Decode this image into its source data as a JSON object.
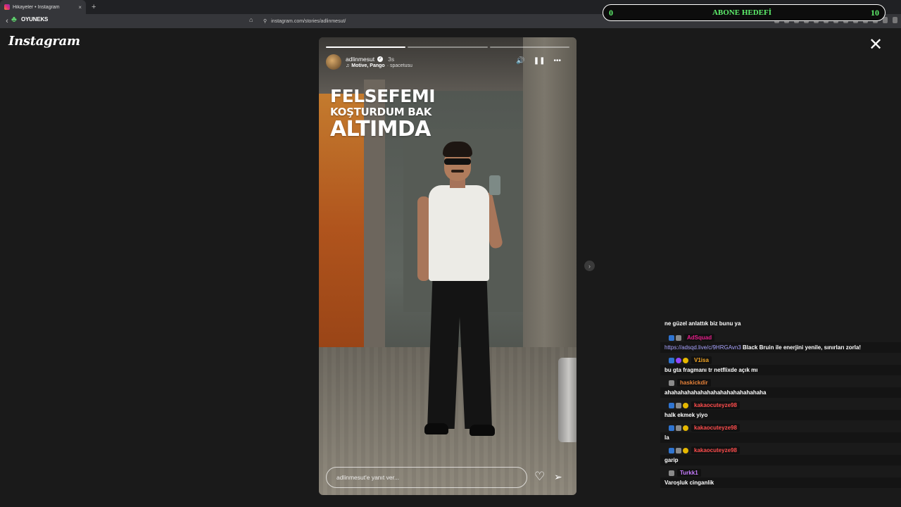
{
  "browser": {
    "tab_title": "Hikayeler • Instagram",
    "tab_close": "×",
    "new_tab": "+",
    "back": "‹",
    "url": "instagram.com/stories/adlinmesut/",
    "site_info": "⚲",
    "bookmark": "⌂"
  },
  "overlay_logo": {
    "mark": "♣",
    "text": "OYUNEKS"
  },
  "sub_goal": {
    "current": "0",
    "label": "ABONE HEDEFİ",
    "target": "10"
  },
  "instagram": {
    "brand": "Instagram",
    "close": "✕",
    "next": "›"
  },
  "story": {
    "progress": [
      1,
      0,
      0
    ],
    "username": "adlinmesut",
    "verified": "✓",
    "age": "3s",
    "music_icon": "♫",
    "song": "Motive, Pango",
    "artist": "· spacetusu",
    "controls": {
      "mute": "🔊",
      "pause": "❚❚",
      "more": "•••"
    },
    "caption": [
      "FELSEFEMI",
      "KOŞTURDUM BAK",
      "ALTIMDA"
    ],
    "reply_placeholder": "adlinmesut'e yanıt ver...",
    "like": "♡",
    "share": "➢"
  },
  "chat": {
    "partial_first": "ne güzel anlattık biz bunu ya",
    "messages": [
      {
        "user": "AdSquad",
        "color": "#e91e8c",
        "badges": [
          "blue",
          "gray"
        ],
        "link": "https://adsqd.live/c/9HRGAvn3",
        "text": "Black Bruin ile enerjini yenile, sınırları zorla!"
      },
      {
        "user": "V1isa",
        "color": "#f5a623",
        "badges": [
          "blue",
          "purple",
          "gold"
        ],
        "link": "",
        "text": "bu gta fragmanı tr netflixde açık mı"
      },
      {
        "user": "haskickdir",
        "color": "#e8833a",
        "badges": [
          "gray"
        ],
        "link": "",
        "text": "ahahahahahahahahahahahahahahaha"
      },
      {
        "user": "kakaocuteyze98",
        "color": "#ff4d4d",
        "badges": [
          "blue",
          "gray",
          "gold"
        ],
        "link": "",
        "text": "halk ekmek yiyo"
      },
      {
        "user": "kakaocuteyze98",
        "color": "#ff4d4d",
        "badges": [
          "blue",
          "gray",
          "gold"
        ],
        "link": "",
        "text": "la"
      },
      {
        "user": "kakaocuteyze98",
        "color": "#ff4d4d",
        "badges": [
          "blue",
          "gray",
          "gold"
        ],
        "link": "",
        "text": "garip"
      },
      {
        "user": "Turkk1",
        "color": "#c77dff",
        "badges": [
          "gray"
        ],
        "link": "",
        "text": "Varoşluk cinganlik"
      }
    ]
  }
}
